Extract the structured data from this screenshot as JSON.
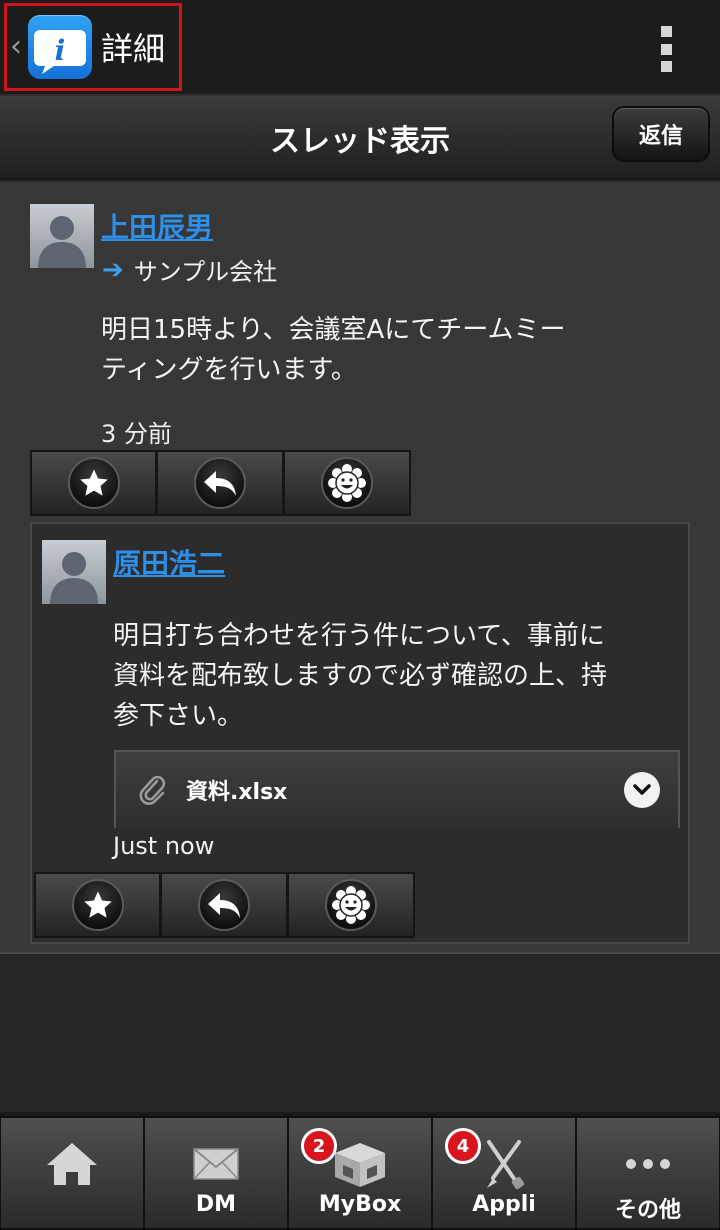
{
  "actionbar": {
    "title": "詳細",
    "back_glyph": "‹"
  },
  "subheader": {
    "title": "スレッド表示",
    "reply_label": "返信"
  },
  "thread": {
    "root": {
      "author": "上田辰男",
      "organization": "サンプル会社",
      "body_line1": "明日15時より、会議室Aにてチームミー",
      "body_line2": "ティングを行います。",
      "time": "3 分前"
    },
    "reply": {
      "author": "原田浩二",
      "body_line1": "明日打ち合わせを行う件について、事前に",
      "body_line2": "資料を配布致しますので必ず確認の上、持",
      "body_line3": "参下さい。",
      "attachment_name": "資料.xlsx",
      "time": "Just now"
    }
  },
  "icons": {
    "favorite": "star-icon",
    "reply": "reply-arrow-icon",
    "reaction": "smiley-flower-icon"
  },
  "nav": {
    "items": [
      {
        "label": "",
        "icon": "home-icon"
      },
      {
        "label": "DM",
        "icon": "envelope-icon"
      },
      {
        "label": "MyBox",
        "icon": "box-icon",
        "badge": "2"
      },
      {
        "label": "Appli",
        "icon": "tools-icon",
        "badge": "4"
      },
      {
        "label": "その他",
        "icon": "more-dots-icon"
      }
    ]
  },
  "colors": {
    "link": "#2d8fe8",
    "badge": "#d8141c",
    "highlight_border": "#d0141b"
  }
}
